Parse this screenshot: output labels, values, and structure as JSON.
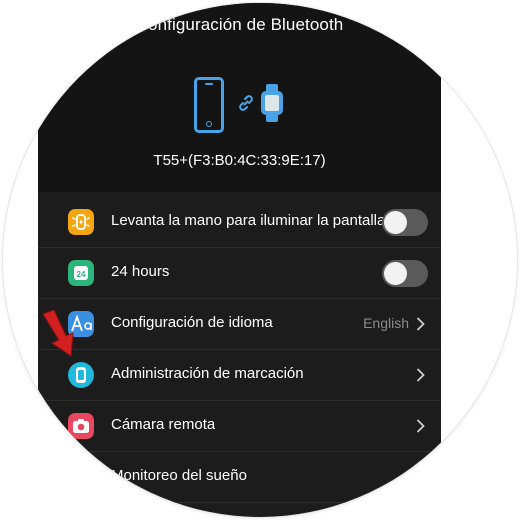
{
  "header": {
    "title": "Configuración de Bluetooth",
    "device_name": "T55+(F3:B0:4C:33:9E:17)"
  },
  "colors": {
    "accent_blue": "#4aa3e6",
    "background": "#1c1c1c",
    "annotation_arrow": "#d21f1f"
  },
  "settings": [
    {
      "label": "Levanta la mano para iluminar la pantalla",
      "icon": "watch-light-icon",
      "control": "toggle",
      "on": false
    },
    {
      "label": "24 hours",
      "icon": "clock-24-icon",
      "control": "toggle",
      "on": false
    },
    {
      "label": "Configuración de idioma",
      "value": "English",
      "icon": "language-icon",
      "control": "chevron"
    },
    {
      "label": "Administración de marcación",
      "icon": "watch-face-icon",
      "control": "chevron"
    },
    {
      "label": "Cámara remota",
      "icon": "camera-icon",
      "control": "chevron"
    },
    {
      "label": "Monitoreo del sueño",
      "icon": "sleep-icon",
      "control": "none"
    }
  ],
  "annotation": {
    "icon": "red-arrow-icon"
  }
}
